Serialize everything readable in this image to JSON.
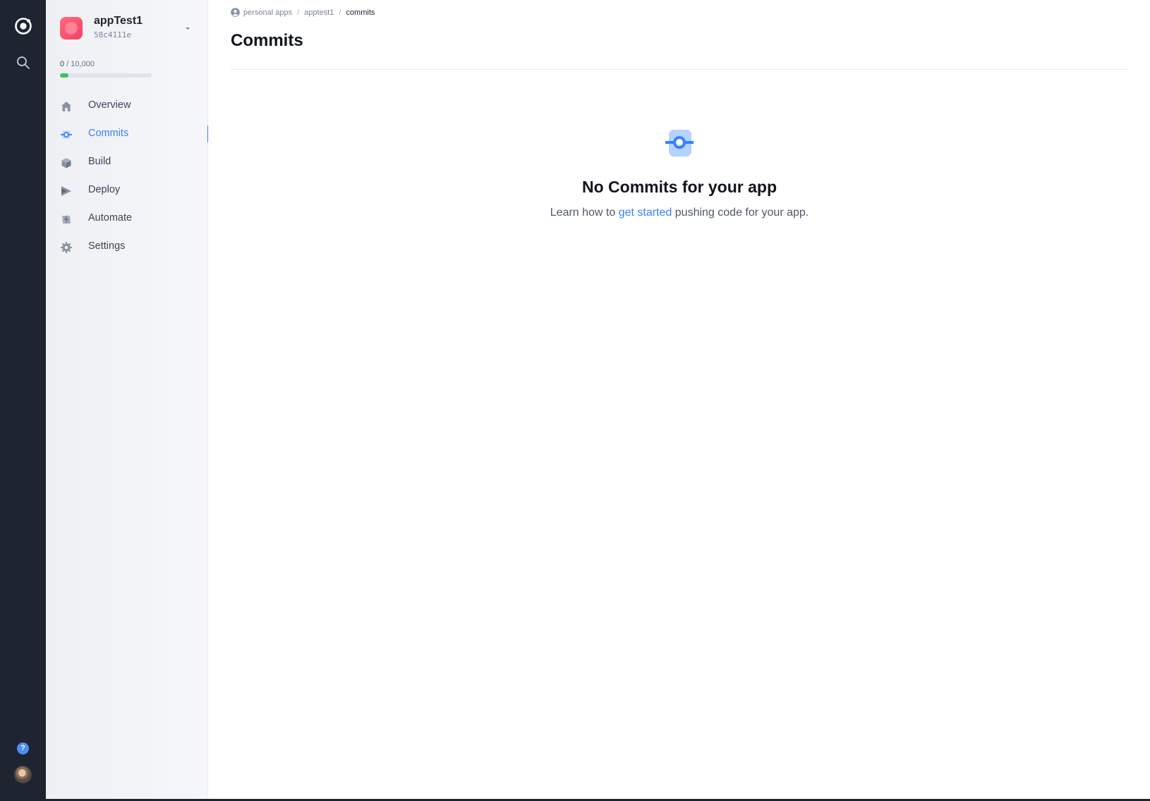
{
  "rail": {
    "logo_icon": "ionic-logo-icon",
    "search_icon": "search-icon",
    "help_label": "?",
    "avatar": "user-avatar"
  },
  "app": {
    "name": "appTest1",
    "id": "58c4111e",
    "quota_used": "0",
    "quota_total": " / 10,000",
    "quota_fraction": 0.09
  },
  "nav": [
    {
      "label": "Overview",
      "icon": "home-icon",
      "active": false
    },
    {
      "label": "Commits",
      "icon": "commit-icon",
      "active": true
    },
    {
      "label": "Build",
      "icon": "cube-icon",
      "active": false
    },
    {
      "label": "Deploy",
      "icon": "play-icon",
      "active": false
    },
    {
      "label": "Automate",
      "icon": "flash-icon",
      "active": false
    },
    {
      "label": "Settings",
      "icon": "gear-icon",
      "active": false
    }
  ],
  "breadcrumb": {
    "items": [
      "personal apps",
      "apptest1",
      "commits"
    ],
    "separator": "/"
  },
  "page": {
    "title": "Commits"
  },
  "empty_state": {
    "title": "No Commits for your app",
    "text_before": "Learn how to ",
    "link": "get started",
    "text_after": " pushing code for your app."
  },
  "colors": {
    "accent": "#3880ff",
    "rail": "#1e2530",
    "quota": "#34c759"
  }
}
